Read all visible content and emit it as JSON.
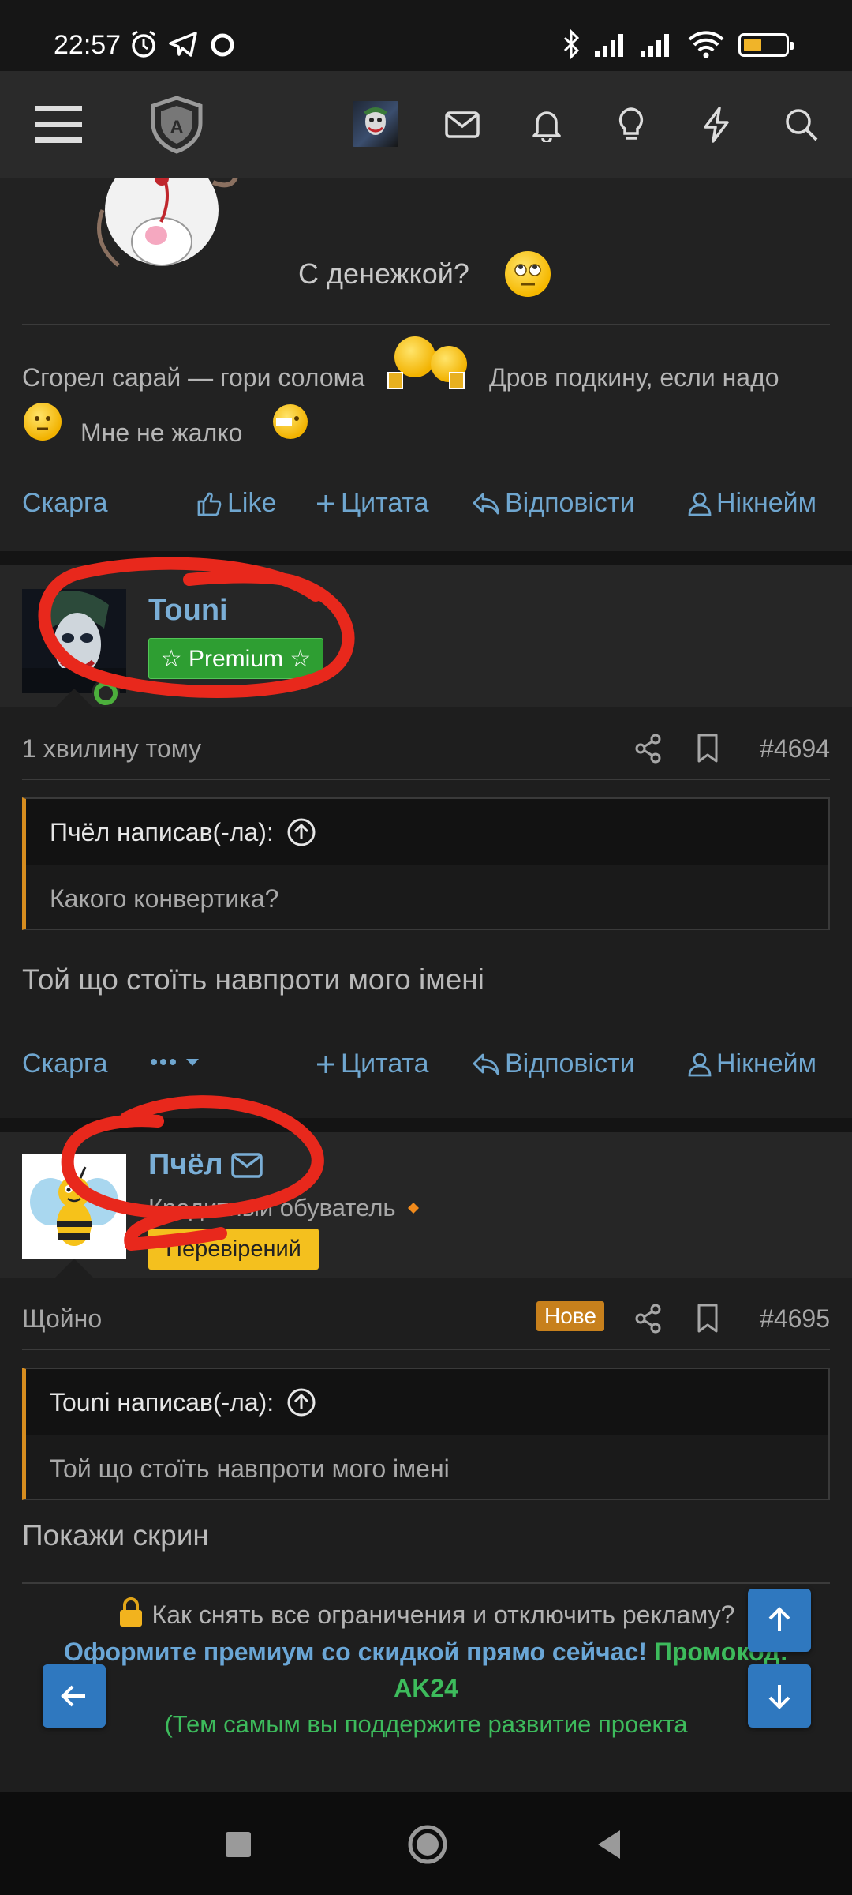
{
  "status_bar": {
    "time": "22:57",
    "icons": [
      "alarm-icon",
      "telegram-icon",
      "circle-icon",
      "bluetooth-icon",
      "signal-icon",
      "signal-icon",
      "wifi-icon",
      "battery-icon"
    ]
  },
  "topnav": {
    "icons": [
      "menu-icon",
      "site-logo",
      "avatar",
      "mail-icon",
      "bell-icon",
      "lightbulb-icon",
      "bolt-icon",
      "search-icon"
    ]
  },
  "prev_post": {
    "caption": "С денежкой?",
    "signature_line1_a": "Сгорел сарай — гори солома",
    "signature_line1_b": "Дров подкину, если надо",
    "signature_line2": "Мне не жалко"
  },
  "actions": {
    "report": "Скарга",
    "like": "Like",
    "quote": "Цитата",
    "reply": "Відповісти",
    "nickname": "Нікнейм"
  },
  "post1": {
    "username": "Touni",
    "badge": "☆ Premium ☆",
    "time": "1 хвилину тому",
    "number": "#4694",
    "quote_author": "Пчёл написав(-ла):",
    "quote_text": "Какого конвертика?",
    "text": "Той що стоїть навпроти мого імені"
  },
  "post2": {
    "username": "Пчёл",
    "user_title": "Кредитный обуватель",
    "badge": "Перевірений",
    "time": "Щойно",
    "new_badge": "Нове",
    "number": "#4695",
    "quote_author": "Touni написав(-ла):",
    "quote_text": "Той що стоїть навпроти мого імені",
    "text": "Покажи скрин"
  },
  "promo": {
    "line1": "Как снять все ограничения и отключить рекламу?",
    "line2_a": "Оформите премиум со скидкой прямо сейчас!",
    "line2_b": "Промокод:",
    "line3": "AK24",
    "line4": "(Тем самым вы поддержите развитие проекта"
  },
  "colors": {
    "link": "#6fa6cf",
    "premium": "#2e9e32",
    "verified": "#f4c01e",
    "quote_bar": "#d78d1f",
    "new_badge": "#c7801c",
    "promo_green": "#3dbb5c",
    "fab": "#2f78bf",
    "annotation_red": "#e8281c"
  }
}
